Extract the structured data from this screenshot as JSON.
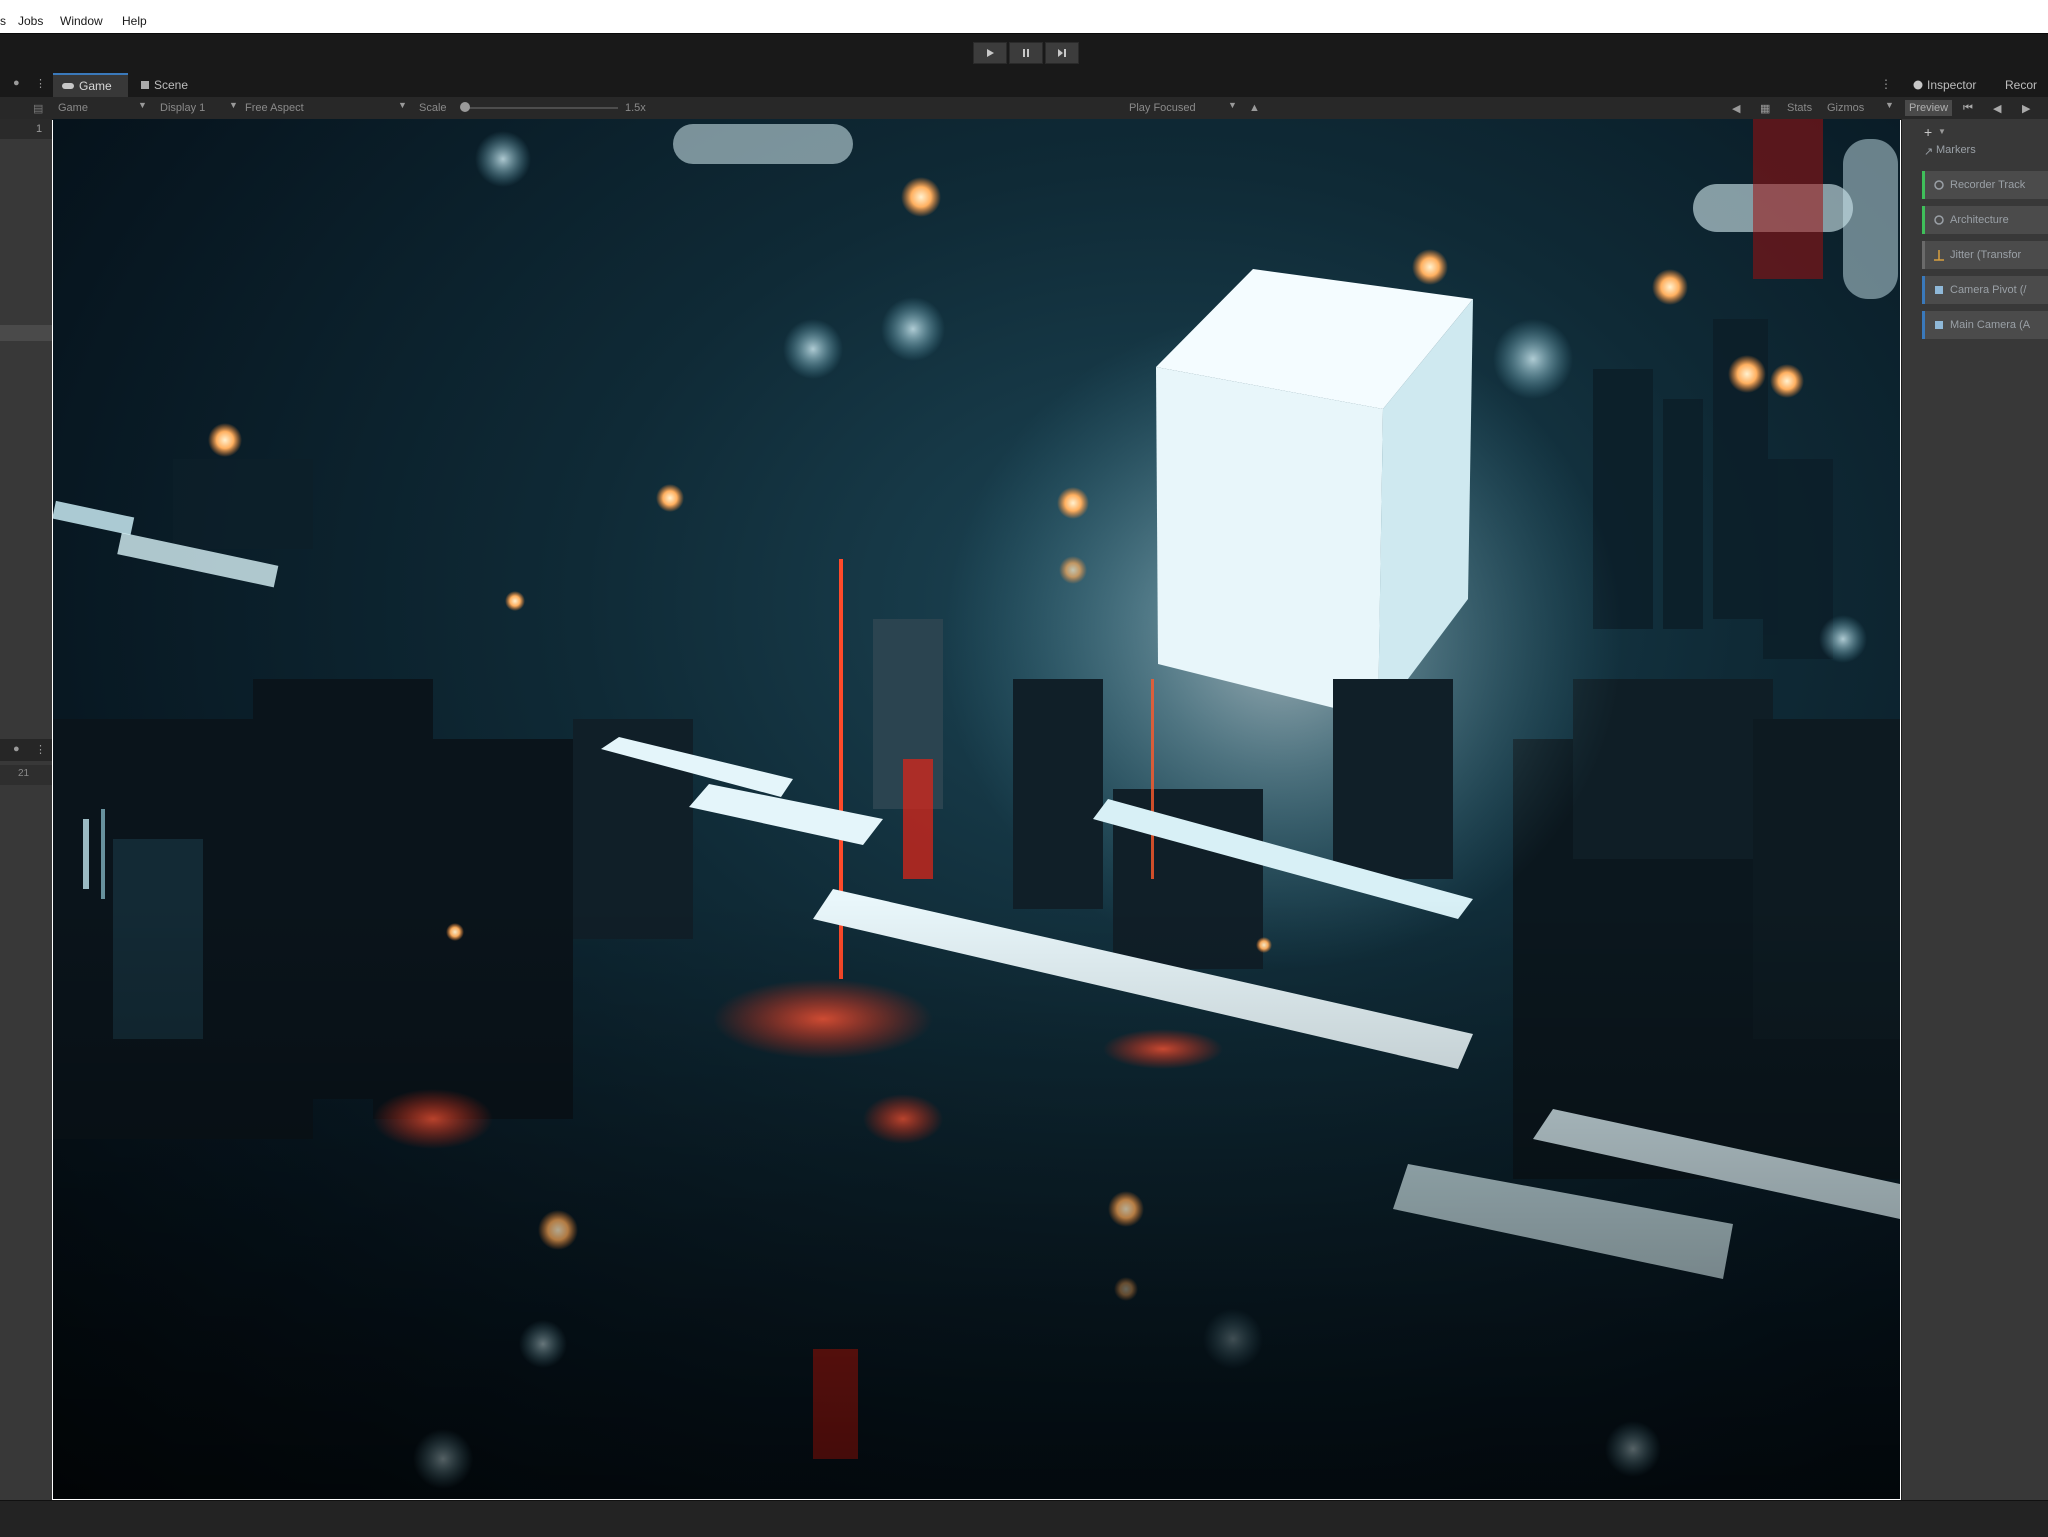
{
  "menu": [
    "s",
    "Jobs",
    "Window",
    "Help"
  ],
  "toolbar": {
    "play_icon": "play-icon",
    "pause_icon": "pause-icon",
    "step_icon": "step-icon"
  },
  "tabs": {
    "game": "Game",
    "scene": "Scene",
    "inspector": "Inspector",
    "recorder": "Recor"
  },
  "game_controls": {
    "game_label": "Game",
    "display": "Display 1",
    "aspect": "Free Aspect",
    "scale_label": "Scale",
    "scale_value": "1.5x",
    "play_mode": "Play Focused",
    "stats": "Stats",
    "gizmos": "Gizmos"
  },
  "left": {
    "row_value": "1",
    "count_badge": "21"
  },
  "timeline": {
    "preview": "Preview",
    "add": "+",
    "markers": "Markers",
    "tracks": [
      {
        "label": "Recorder Track",
        "icon": "recorder-icon",
        "color": "#3fbf5a"
      },
      {
        "label": "Architecture",
        "icon": "recorder-icon",
        "color": "#3fbf5a"
      },
      {
        "label": "Jitter (Transfor",
        "icon": "animation-icon",
        "color": "#6a6a6a"
      },
      {
        "label": "Camera Pivot (/",
        "icon": "activation-icon",
        "color": "#3a79bb"
      },
      {
        "label": "Main Camera (A",
        "icon": "activation-icon",
        "color": "#3a79bb"
      }
    ]
  },
  "colors": {
    "accent": "#3a79bb",
    "cube_glow": "#e8f6fa",
    "red_light": "#ff3a2a",
    "amber_bokeh": "#ffb060"
  }
}
